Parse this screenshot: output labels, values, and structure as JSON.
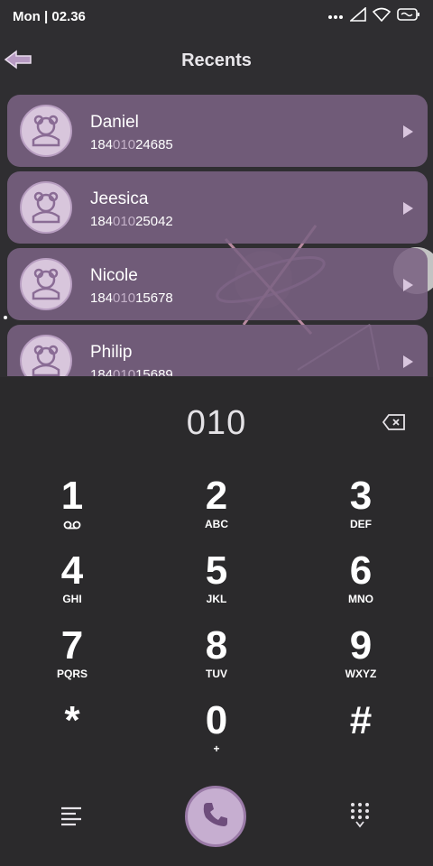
{
  "status": {
    "time": "Mon | 02.36",
    "icons": [
      "dots-icon",
      "signal-icon",
      "wifi-icon",
      "battery-icon"
    ]
  },
  "header": {
    "title": "Recents"
  },
  "recents": [
    {
      "name": "Daniel",
      "number_prefix": "184",
      "number_match": "010",
      "number_suffix": "24685"
    },
    {
      "name": "Jeesica",
      "number_prefix": "184",
      "number_match": "010",
      "number_suffix": "25042"
    },
    {
      "name": "Nicole",
      "number_prefix": "184",
      "number_match": "010",
      "number_suffix": "15678"
    },
    {
      "name": "Philip",
      "number_prefix": "184",
      "number_match": "010",
      "number_suffix": "15689"
    }
  ],
  "dialer": {
    "input": "010",
    "keys": [
      {
        "digit": "1",
        "letters": ""
      },
      {
        "digit": "2",
        "letters": "ABC"
      },
      {
        "digit": "3",
        "letters": "DEF"
      },
      {
        "digit": "4",
        "letters": "GHI"
      },
      {
        "digit": "5",
        "letters": "JKL"
      },
      {
        "digit": "6",
        "letters": "MNO"
      },
      {
        "digit": "7",
        "letters": "PQRS"
      },
      {
        "digit": "8",
        "letters": "TUV"
      },
      {
        "digit": "9",
        "letters": "WXYZ"
      },
      {
        "digit": "*",
        "letters": ""
      },
      {
        "digit": "0",
        "letters": "+"
      },
      {
        "digit": "#",
        "letters": ""
      }
    ]
  },
  "colors": {
    "accent": "#c6aed0",
    "card": "#7a6282",
    "background": "#2b2a2c"
  }
}
